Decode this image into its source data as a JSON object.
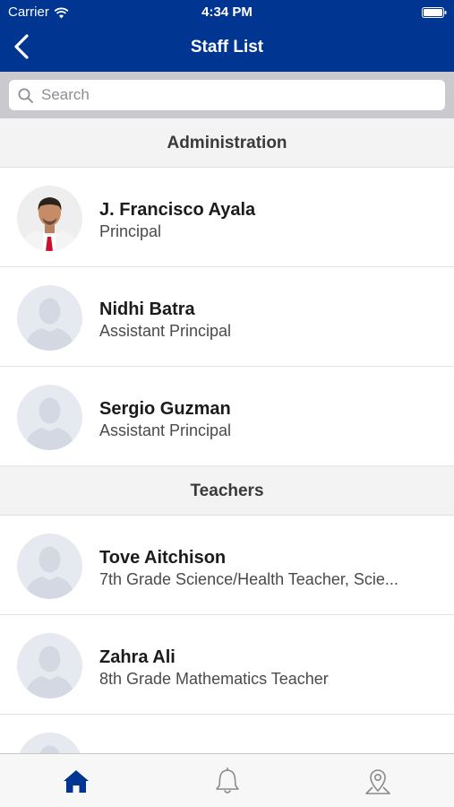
{
  "status_bar": {
    "carrier": "Carrier",
    "time": "4:34 PM"
  },
  "header": {
    "title": "Staff List",
    "background_color": "#003591"
  },
  "search": {
    "placeholder": "Search"
  },
  "sections": [
    {
      "title": "Administration",
      "staff": [
        {
          "name": "J. Francisco Ayala",
          "role": "Principal",
          "avatar": "photo"
        },
        {
          "name": "Nidhi Batra",
          "role": "Assistant Principal",
          "avatar": "placeholder-person-icon"
        },
        {
          "name": "Sergio Guzman",
          "role": "Assistant Principal",
          "avatar": "placeholder-person-icon"
        }
      ]
    },
    {
      "title": "Teachers",
      "staff": [
        {
          "name": "Tove Aitchison",
          "role": "7th Grade Science/Health Teacher, Scie...",
          "avatar": "placeholder-person-icon"
        },
        {
          "name": "Zahra Ali",
          "role": "8th Grade Mathematics Teacher",
          "avatar": "placeholder-person-icon"
        },
        {
          "name": "",
          "role": "",
          "avatar": "placeholder-person-icon"
        }
      ]
    }
  ],
  "tab_bar": {
    "items": [
      {
        "icon": "home-icon",
        "selected": true
      },
      {
        "icon": "bell-icon",
        "selected": false
      },
      {
        "icon": "map-pin-icon",
        "selected": false
      }
    ],
    "active_color": "#003591",
    "inactive_color": "#8a8a8a"
  }
}
